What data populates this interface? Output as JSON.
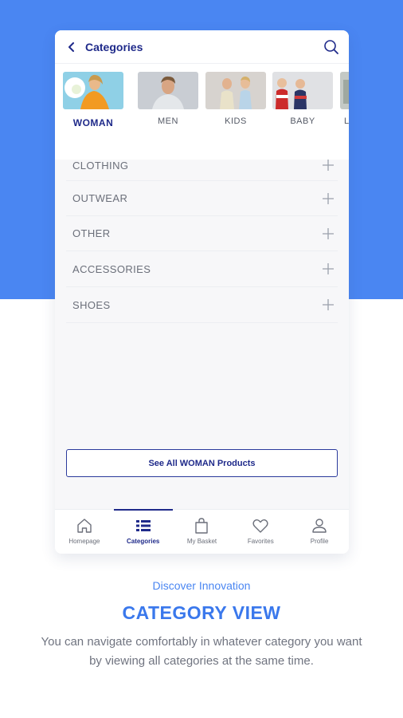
{
  "header": {
    "title": "Categories",
    "back_icon": "chevron-left-icon",
    "search_icon": "search-icon"
  },
  "categories": [
    {
      "label": "WOMAN",
      "active": true
    },
    {
      "label": "MEN",
      "active": false
    },
    {
      "label": "KIDS",
      "active": false
    },
    {
      "label": "BABY",
      "active": false
    },
    {
      "label": "L",
      "active": false
    }
  ],
  "sections": [
    {
      "label": "CLOTHING"
    },
    {
      "label": "OUTWEAR"
    },
    {
      "label": "OTHER"
    },
    {
      "label": "ACCESSORIES"
    },
    {
      "label": "SHOES"
    }
  ],
  "see_all_button": "See All WOMAN Products",
  "bottom_nav": [
    {
      "label": "Homepage",
      "icon": "home-icon",
      "active": false
    },
    {
      "label": "Categories",
      "icon": "list-icon",
      "active": true
    },
    {
      "label": "My Basket",
      "icon": "bag-icon",
      "active": false
    },
    {
      "label": "Favorites",
      "icon": "heart-icon",
      "active": false
    },
    {
      "label": "Profile",
      "icon": "user-icon",
      "active": false
    }
  ],
  "promo": {
    "tagline": "Discover Innovation",
    "headline": "CATEGORY VIEW",
    "description": "You can navigate comfortably in whatever category you want by viewing all categories at the same time."
  },
  "colors": {
    "brand_blue": "#4a86f2",
    "navy": "#1f2a8a",
    "text_gray": "#6b6f7a"
  }
}
